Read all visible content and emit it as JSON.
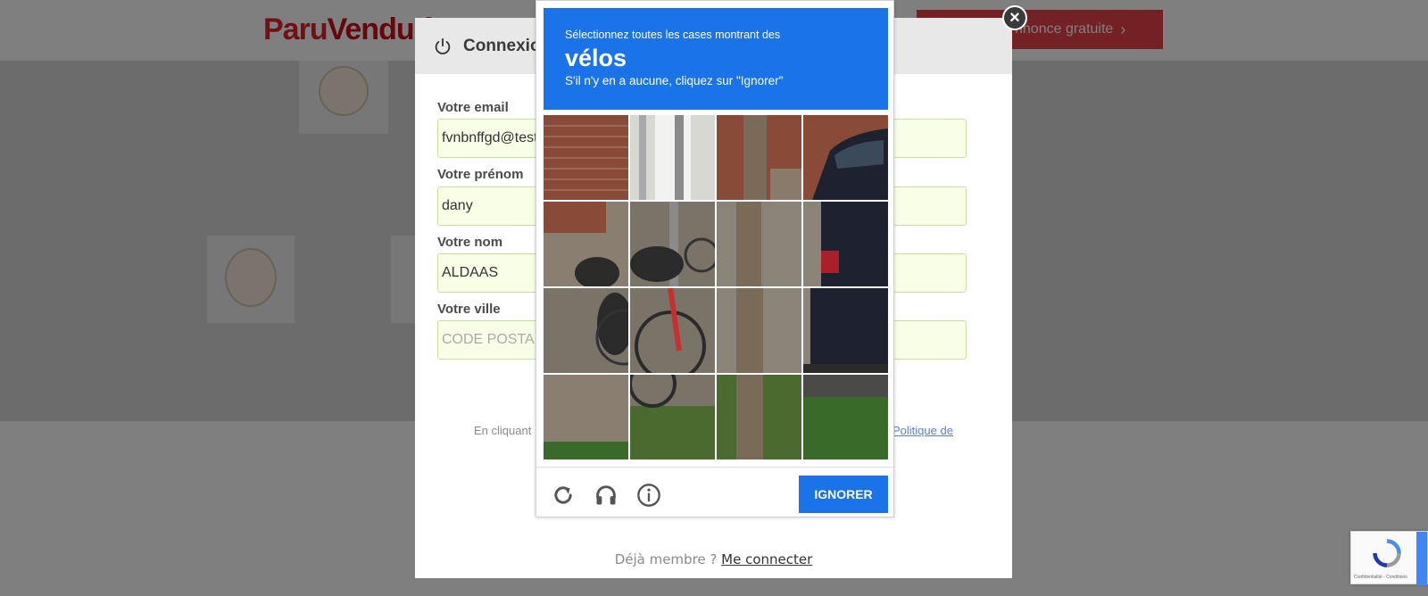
{
  "site": {
    "logo_part1": "Paru",
    "logo_part2": "Vendu.f",
    "post_ad_label": "nnonce gratuite"
  },
  "modal": {
    "title": "Connexio",
    "fields": [
      {
        "label": "Votre email",
        "value": "fvnbnffgd@test"
      },
      {
        "label": "Votre prénom",
        "value": "dany"
      },
      {
        "label": "Votre nom",
        "value": "ALDAAS"
      },
      {
        "label": "Votre ville",
        "value": "CODE POSTAL"
      }
    ],
    "terms_text": "En cliquant",
    "terms_link": "Politique de",
    "member_prompt": "Déjà membre ?",
    "member_link": "Me connecter"
  },
  "captcha": {
    "instruction": "Sélectionnez toutes les cases montrant des",
    "target": "vélos",
    "hint": "S'il n'y en a aucune, cliquez sur \"Ignorer\"",
    "skip_label": "IGNORER",
    "icons": [
      "reload-icon",
      "audio-icon",
      "info-icon"
    ],
    "tile_count": 16
  },
  "recaptcha_badge": {
    "text": "Confidentialité - Conditions"
  },
  "colors": {
    "captcha_blue": "#1a73e8",
    "field_bg": "#f8ffe6",
    "brand_red": "#e2232a"
  }
}
